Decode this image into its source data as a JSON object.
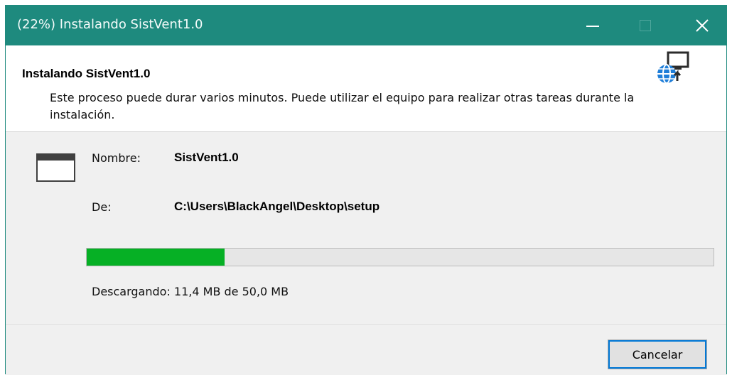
{
  "window": {
    "title": "(22%) Instalando SistVent1.0",
    "titlebar_color": "#1e8a7e",
    "controls": {
      "minimize": "minimize-icon",
      "maximize": "maximize-icon",
      "close": "close-icon",
      "close_glyph": "✕"
    }
  },
  "header": {
    "title": "Instalando SistVent1.0",
    "description": "Este proceso puede durar varios minutos. Puede utilizar el equipo para realizar otras tareas durante la instalación.",
    "icon": "globe-install-icon"
  },
  "details": {
    "app_icon": "window-icon",
    "name_label": "Nombre:",
    "name_value": "SistVent1.0",
    "from_label": "De:",
    "from_value": "C:\\Users\\BlackAngel\\Desktop\\setup"
  },
  "progress": {
    "fraction": 0.22,
    "fill_color": "#06b025",
    "status_text": "Descargando: 11,4 MB de 50,0 MB"
  },
  "footer": {
    "cancel_label": "Cancelar",
    "focus_color": "#0078d7"
  }
}
